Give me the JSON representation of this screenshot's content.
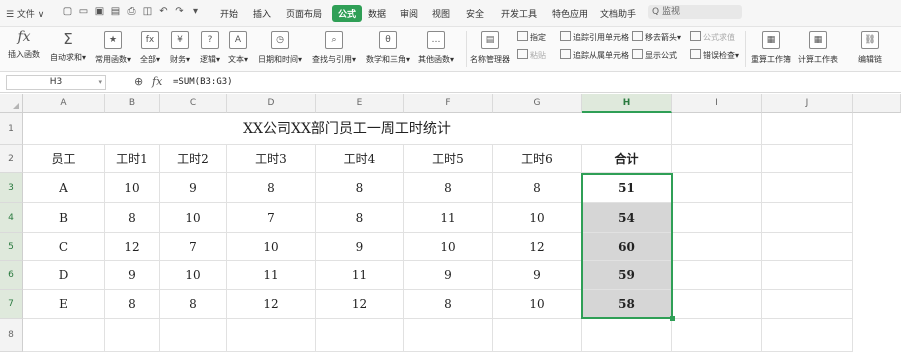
{
  "menubar": {
    "file_label": "☰ 文件 ∨",
    "tabs": [
      {
        "label": "开始",
        "active": false
      },
      {
        "label": "插入",
        "active": false
      },
      {
        "label": "页面布局",
        "active": false
      },
      {
        "label": "公式",
        "active": true
      },
      {
        "label": "数据",
        "active": false
      },
      {
        "label": "审阅",
        "active": false
      },
      {
        "label": "视图",
        "active": false
      },
      {
        "label": "安全",
        "active": false
      },
      {
        "label": "开发工具",
        "active": false
      },
      {
        "label": "特色应用",
        "active": false
      },
      {
        "label": "文档助手",
        "active": false
      }
    ],
    "search_label": "Q 监视"
  },
  "ribbon": {
    "big_buttons": [
      {
        "label": "插入函数",
        "icon": "fx"
      },
      {
        "label": "自动求和▾",
        "icon": "Σ"
      },
      {
        "label": "常用函数▾",
        "icon": "★"
      },
      {
        "label": "全部▾",
        "icon": "fx"
      },
      {
        "label": "财务▾",
        "icon": "¥"
      },
      {
        "label": "逻辑▾",
        "icon": "?"
      },
      {
        "label": "文本▾",
        "icon": "A"
      },
      {
        "label": "日期和时间▾",
        "icon": "◷"
      },
      {
        "label": "查找与引用▾",
        "icon": "⌕"
      },
      {
        "label": "数学和三角▾",
        "icon": "θ"
      },
      {
        "label": "其他函数▾",
        "icon": "…"
      },
      {
        "label": "名称管理器",
        "icon": "▤"
      },
      {
        "label": "重算工作簿",
        "icon": "▦"
      },
      {
        "label": "计算工作表",
        "icon": "▦"
      },
      {
        "label": "编辑链",
        "icon": "⛓"
      }
    ],
    "small": {
      "specify": "指定",
      "paste": "粘贴",
      "trace_precedents": "追踪引用单元格",
      "trace_dependents": "追踪从属单元格",
      "remove_arrows": "移去箭头▾",
      "show_formulas": "显示公式",
      "evaluate": "公式求值",
      "error_check": "错误检查▾"
    }
  },
  "formula_bar": {
    "cell_ref": "H3",
    "zoom_icon": "⊕",
    "fx_icon": "fx",
    "formula": "=SUM(B3:G3)"
  },
  "sheet": {
    "columns": [
      "A",
      "B",
      "C",
      "D",
      "E",
      "F",
      "G",
      "H",
      "I",
      "J"
    ],
    "row_numbers": [
      "1",
      "2",
      "3",
      "4",
      "5",
      "6",
      "7",
      "8"
    ],
    "title": "XX公司XX部门员工一周工时统计",
    "headers": [
      "员工",
      "工时1",
      "工时2",
      "工时3",
      "工时4",
      "工时5",
      "工时6",
      "合计"
    ],
    "rows": [
      [
        "A",
        "10",
        "9",
        "8",
        "8",
        "8",
        "8",
        "51"
      ],
      [
        "B",
        "8",
        "10",
        "7",
        "8",
        "11",
        "10",
        "54"
      ],
      [
        "C",
        "12",
        "7",
        "10",
        "9",
        "10",
        "12",
        "60"
      ],
      [
        "D",
        "9",
        "10",
        "11",
        "11",
        "9",
        "9",
        "59"
      ],
      [
        "E",
        "8",
        "8",
        "12",
        "12",
        "8",
        "10",
        "58"
      ]
    ],
    "active_cell": "H3"
  }
}
